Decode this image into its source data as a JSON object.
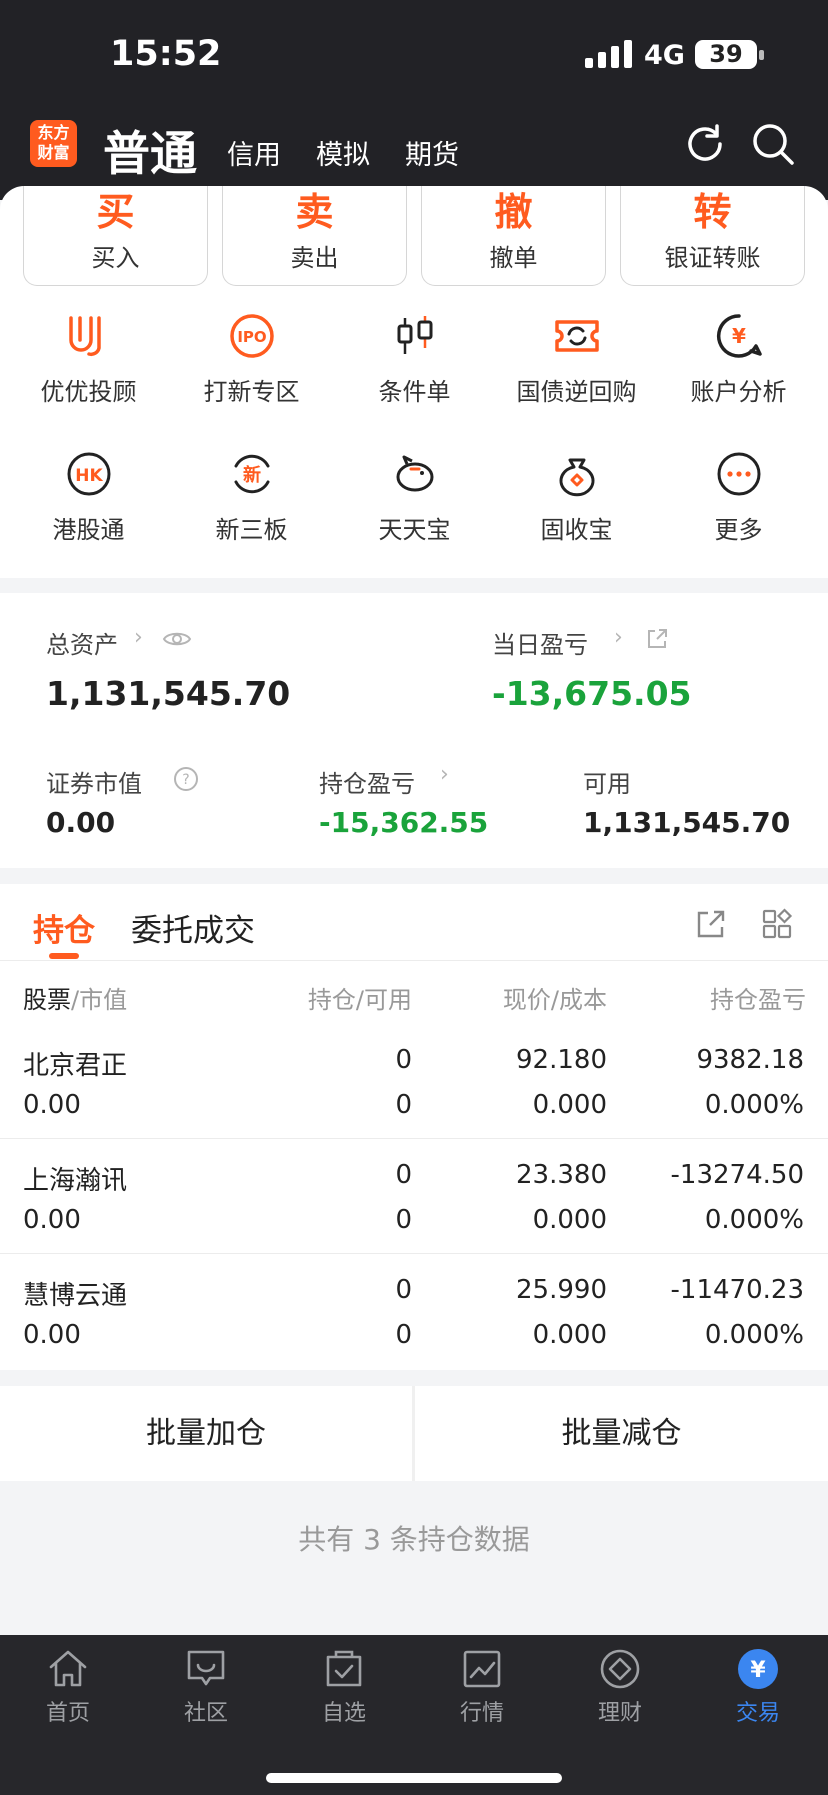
{
  "status": {
    "time": "15:52",
    "network": "4G",
    "battery": "39"
  },
  "header": {
    "logo": "东方财富",
    "active_tab": "普通",
    "tabs": [
      "信用",
      "模拟",
      "期货"
    ]
  },
  "trade_buttons": [
    {
      "big": "买",
      "label": "买入"
    },
    {
      "big": "卖",
      "label": "卖出"
    },
    {
      "big": "撤",
      "label": "撤单"
    },
    {
      "big": "转",
      "label": "银证转账"
    }
  ],
  "features_row1": [
    "优优投顾",
    "打新专区",
    "条件单",
    "国债逆回购",
    "账户分析"
  ],
  "features_row2": [
    "港股通",
    "新三板",
    "天天宝",
    "固收宝",
    "更多"
  ],
  "feature_icon_text": {
    "ipo": "IPO",
    "hk": "HK",
    "new": "新",
    "more": "···"
  },
  "assets": {
    "total_label": "总资产",
    "total_value": "1,131,545.70",
    "daily_label": "当日盈亏",
    "daily_value": "-13,675.05",
    "market_label": "证券市值",
    "market_value": "0.00",
    "hold_pl_label": "持仓盈亏",
    "hold_pl_value": "-15,362.55",
    "avail_label": "可用",
    "avail_value": "1,131,545.70"
  },
  "positions": {
    "tabs": [
      "持仓",
      "委托成交"
    ],
    "headers": {
      "c1a": "股票",
      "c1b": "市值",
      "c2a": "持仓",
      "c2b": "可用",
      "c3a": "现价",
      "c3b": "成本",
      "c4": "持仓盈亏"
    },
    "rows": [
      {
        "name": "北京君正",
        "mv": "0.00",
        "hold": "0",
        "avail": "0",
        "price": "92.180",
        "cost": "0.000",
        "pl": "9382.18",
        "pct": "0.000%",
        "dir": "up"
      },
      {
        "name": "上海瀚讯",
        "mv": "0.00",
        "hold": "0",
        "avail": "0",
        "price": "23.380",
        "cost": "0.000",
        "pl": "-13274.50",
        "pct": "0.000%",
        "dir": "down"
      },
      {
        "name": "慧博云通",
        "mv": "0.00",
        "hold": "0",
        "avail": "0",
        "price": "25.990",
        "cost": "0.000",
        "pl": "-11470.23",
        "pct": "0.000%",
        "dir": "down"
      }
    ],
    "batch_add": "批量加仓",
    "batch_reduce": "批量减仓",
    "summary": "共有 3 条持仓数据"
  },
  "nav": [
    {
      "label": "首页",
      "icon": "home-icon"
    },
    {
      "label": "社区",
      "icon": "chat-icon"
    },
    {
      "label": "自选",
      "icon": "watchlist-icon"
    },
    {
      "label": "行情",
      "icon": "chart-icon"
    },
    {
      "label": "理财",
      "icon": "diamond-icon"
    },
    {
      "label": "交易",
      "icon": "yen-icon",
      "active": true
    }
  ],
  "colors": {
    "accent": "#ff5b1f",
    "up": "#e4161c",
    "down": "#1aa33b",
    "nav_active": "#3b86f0"
  }
}
